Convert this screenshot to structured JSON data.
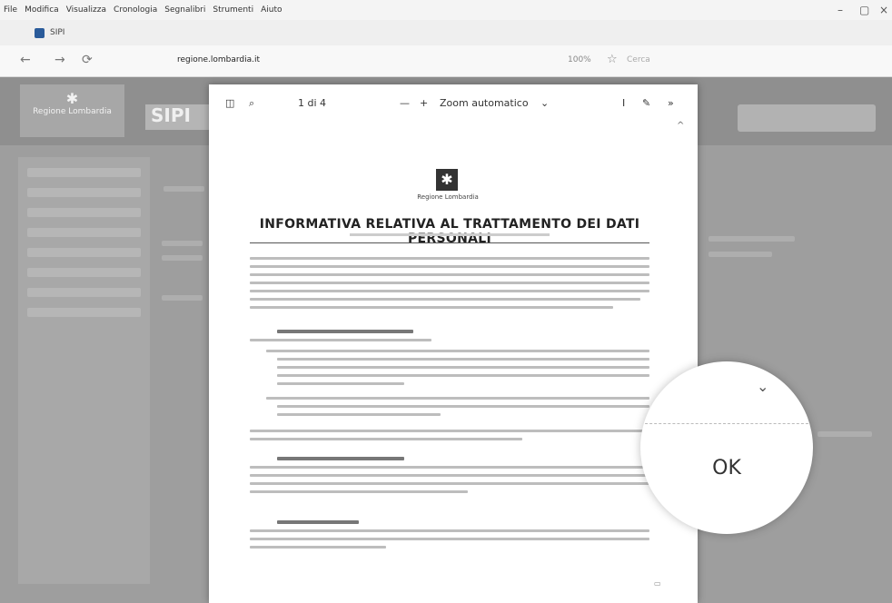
{
  "browser": {
    "menu": [
      "File",
      "Modifica",
      "Visualizza",
      "Cronologia",
      "Segnalibri",
      "Strumenti",
      "Aiuto"
    ],
    "tab_title": "SIPI",
    "url_domain": "regione.lombardia.it",
    "zoom": "100%",
    "controls": {
      "minimize": "–",
      "maximize": "▢",
      "close": "×"
    },
    "nav": {
      "back": "←",
      "forward": "→",
      "reload": "⟳"
    },
    "search_placeholder": "Cerca"
  },
  "background_page": {
    "logo_text": "Regione Lombardia",
    "app_name": "SIPI"
  },
  "pdf_viewer": {
    "page_indicator": "1 di 4",
    "zoom_out": "—",
    "zoom_in": "+",
    "zoom_label": "Zoom automatico",
    "document": {
      "logo_text": "Regione Lombardia",
      "title": "INFORMATIVA RELATIVA AL TRATTAMENTO DEI DATI PERSONALI",
      "section_numbers": [
        "1.",
        "2.",
        "3."
      ]
    }
  },
  "popup": {
    "ok_label": "OK"
  },
  "icons": [
    "sidebar-toggle-icon",
    "search-icon",
    "text-cursor-icon",
    "draw-icon",
    "more-tools-icon",
    "star-icon",
    "chevron-down-icon"
  ]
}
